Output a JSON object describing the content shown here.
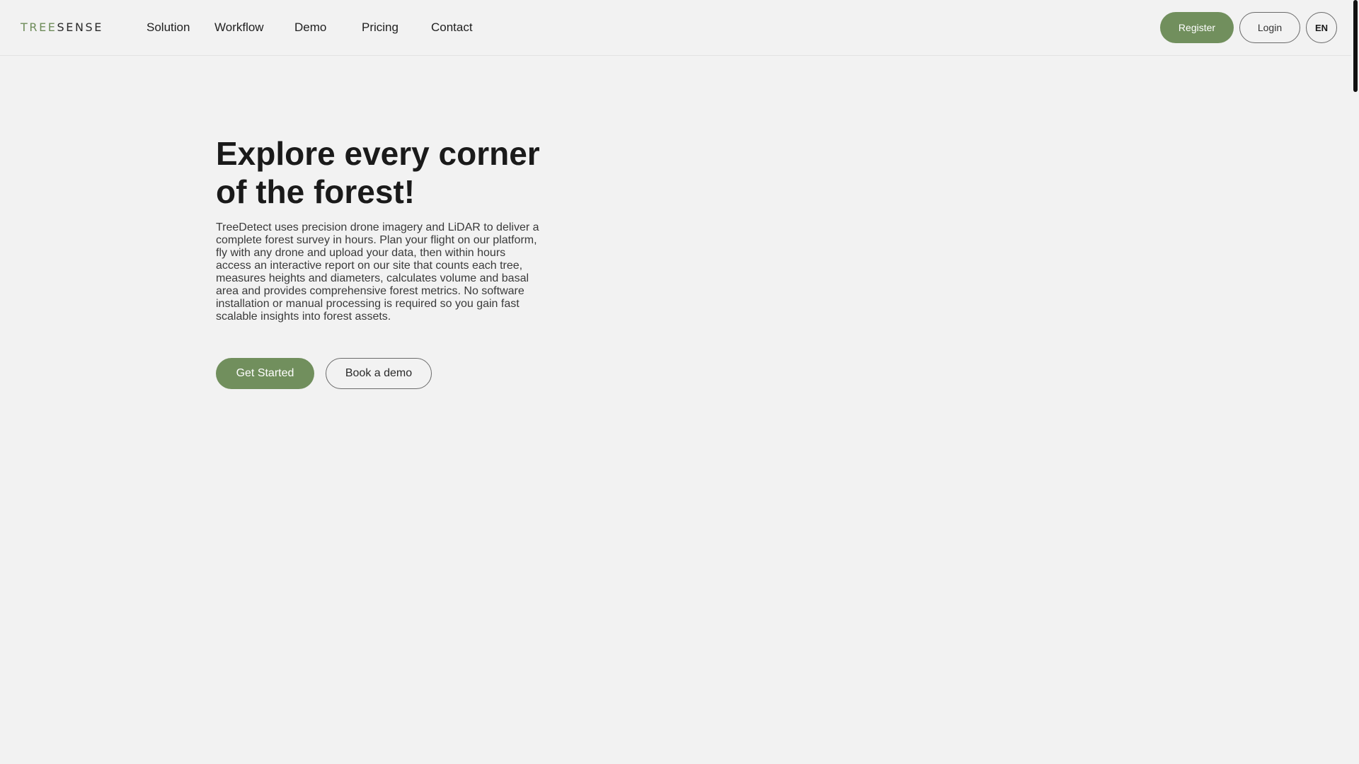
{
  "brand": {
    "part_a": "TREE",
    "part_b": "SENSE"
  },
  "nav": {
    "items": [
      {
        "label": "Solution"
      },
      {
        "label": "Workflow"
      },
      {
        "label": "Demo"
      },
      {
        "label": "Pricing"
      },
      {
        "label": "Contact"
      }
    ],
    "register_label": "Register",
    "login_label": "Login",
    "language": "EN"
  },
  "hero": {
    "title_line1": "Explore every corner",
    "title_line2": "of the forest!",
    "description": "TreeDetect uses precision drone imagery and LiDAR to deliver a complete forest survey in hours. Plan your flight on our platform, fly with any drone and upload your data, then within hours access an interactive report on our site that counts each tree, measures heights and diameters, calculates volume and basal area and provides comprehensive forest metrics. No software installation or manual processing is required so you gain fast scalable insights into forest assets.",
    "primary_cta": "Get Started",
    "secondary_cta": "Book a demo"
  },
  "colors": {
    "accent": "#718f5d",
    "logo_green": "#6e8c5a",
    "background": "#f2f2f2",
    "text": "#1a1a1a"
  }
}
